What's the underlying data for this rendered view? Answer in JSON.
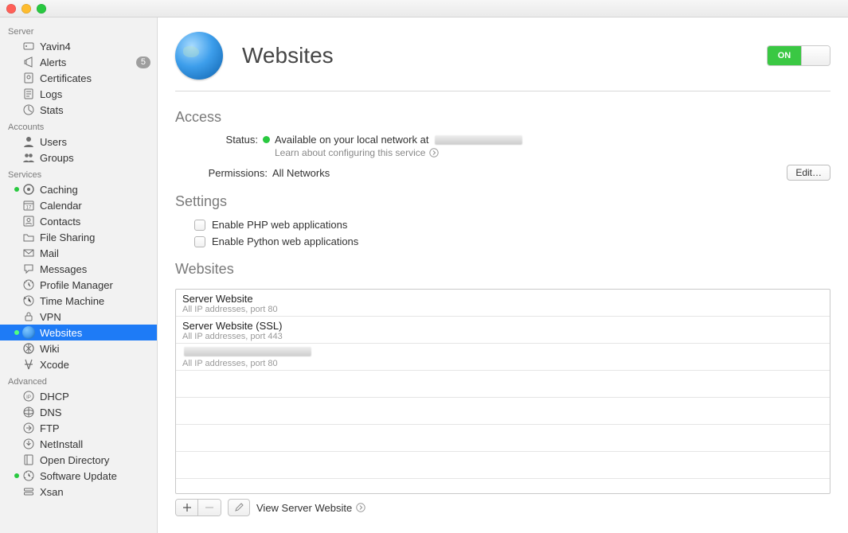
{
  "sidebar": {
    "sections": [
      {
        "title": "Server",
        "items": [
          {
            "label": "Yavin4",
            "icon": "server"
          },
          {
            "label": "Alerts",
            "icon": "megaphone",
            "badge": "5"
          },
          {
            "label": "Certificates",
            "icon": "cert"
          },
          {
            "label": "Logs",
            "icon": "logs"
          },
          {
            "label": "Stats",
            "icon": "stats"
          }
        ]
      },
      {
        "title": "Accounts",
        "items": [
          {
            "label": "Users",
            "icon": "user"
          },
          {
            "label": "Groups",
            "icon": "group"
          }
        ]
      },
      {
        "title": "Services",
        "items": [
          {
            "label": "Caching",
            "icon": "caching",
            "running": true
          },
          {
            "label": "Calendar",
            "icon": "calendar"
          },
          {
            "label": "Contacts",
            "icon": "contacts"
          },
          {
            "label": "File Sharing",
            "icon": "folder"
          },
          {
            "label": "Mail",
            "icon": "mail"
          },
          {
            "label": "Messages",
            "icon": "messages"
          },
          {
            "label": "Profile Manager",
            "icon": "profile"
          },
          {
            "label": "Time Machine",
            "icon": "timemachine"
          },
          {
            "label": "VPN",
            "icon": "vpn"
          },
          {
            "label": "Websites",
            "icon": "globe",
            "running": true,
            "selected": true
          },
          {
            "label": "Wiki",
            "icon": "wiki"
          },
          {
            "label": "Xcode",
            "icon": "xcode"
          }
        ]
      },
      {
        "title": "Advanced",
        "items": [
          {
            "label": "DHCP",
            "icon": "dhcp"
          },
          {
            "label": "DNS",
            "icon": "dns"
          },
          {
            "label": "FTP",
            "icon": "ftp"
          },
          {
            "label": "NetInstall",
            "icon": "netinstall"
          },
          {
            "label": "Open Directory",
            "icon": "opendir"
          },
          {
            "label": "Software Update",
            "icon": "swupdate",
            "running": true
          },
          {
            "label": "Xsan",
            "icon": "xsan"
          }
        ]
      }
    ]
  },
  "header": {
    "title": "Websites",
    "toggle_on": "ON"
  },
  "access": {
    "heading": "Access",
    "status_label": "Status:",
    "status_text": "Available on your local network at",
    "learn_text": "Learn about configuring this service",
    "permissions_label": "Permissions:",
    "permissions_value": "All Networks",
    "edit_button": "Edit…"
  },
  "settings": {
    "heading": "Settings",
    "opts": [
      "Enable PHP web applications",
      "Enable Python web applications"
    ]
  },
  "websites": {
    "heading": "Websites",
    "rows": [
      {
        "name": "Server Website",
        "sub": "All IP addresses, port 80"
      },
      {
        "name": "Server Website (SSL)",
        "sub": "All IP addresses, port 443"
      },
      {
        "name": "",
        "redacted": true,
        "sub": "All IP addresses, port 80"
      }
    ],
    "view_label": "View Server Website"
  }
}
